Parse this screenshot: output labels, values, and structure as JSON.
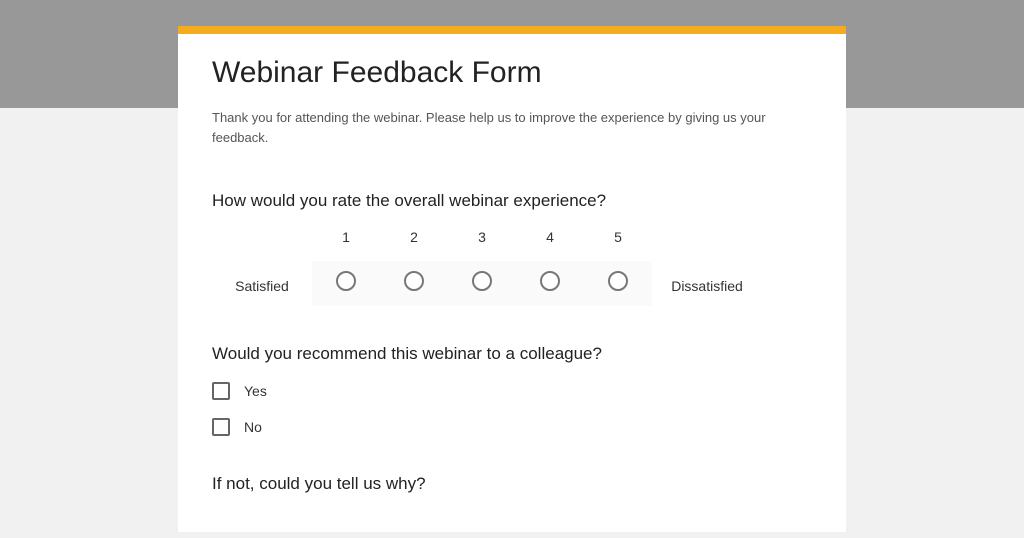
{
  "form": {
    "title": "Webinar Feedback Form",
    "description": "Thank you for attending the webinar. Please help us to improve the experience by giving us your feedback."
  },
  "q1": {
    "title": "How would you rate the overall webinar experience?",
    "low_label": "Satisfied",
    "high_label": "Dissatisfied",
    "scale": [
      "1",
      "2",
      "3",
      "4",
      "5"
    ]
  },
  "q2": {
    "title": "Would you recommend this webinar to a colleague?",
    "options": [
      "Yes",
      "No"
    ]
  },
  "q3": {
    "title": "If not, could you tell us why?"
  }
}
